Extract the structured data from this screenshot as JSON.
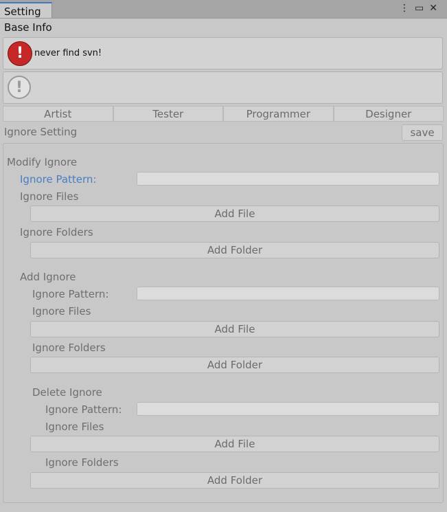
{
  "window": {
    "tab_title": "Setting",
    "menu_icon": "⋮",
    "maximize_icon": "▭",
    "close_icon": "✕"
  },
  "base_info": {
    "label": "Base Info",
    "error_message": "never find svn!",
    "error_icon": "!",
    "warning_icon": "!"
  },
  "roles": [
    "Artist",
    "Tester",
    "Programmer",
    "Designer"
  ],
  "ignore_setting": {
    "label": "Ignore Setting",
    "save_label": "save"
  },
  "modify": {
    "title": "Modify Ignore",
    "pattern_label": "Ignore Pattern:",
    "pattern_value": "",
    "files_label": "Ignore Files",
    "add_file": "Add File",
    "folders_label": "Ignore Folders",
    "add_folder": "Add Folder"
  },
  "add": {
    "title": "Add Ignore",
    "pattern_label": "Ignore Pattern:",
    "pattern_value": "",
    "files_label": "Ignore Files",
    "add_file": "Add File",
    "folders_label": "Ignore Folders",
    "add_folder": "Add Folder"
  },
  "delete": {
    "title": "Delete Ignore",
    "pattern_label": "Ignore Pattern:",
    "pattern_value": "",
    "files_label": "Ignore Files",
    "add_file": "Add File",
    "folders_label": "Ignore Folders",
    "add_folder": "Add Folder"
  },
  "colors": {
    "accent_tab": "#3a79bb",
    "focus_label": "#4a7ec4",
    "error": "#c62828"
  }
}
